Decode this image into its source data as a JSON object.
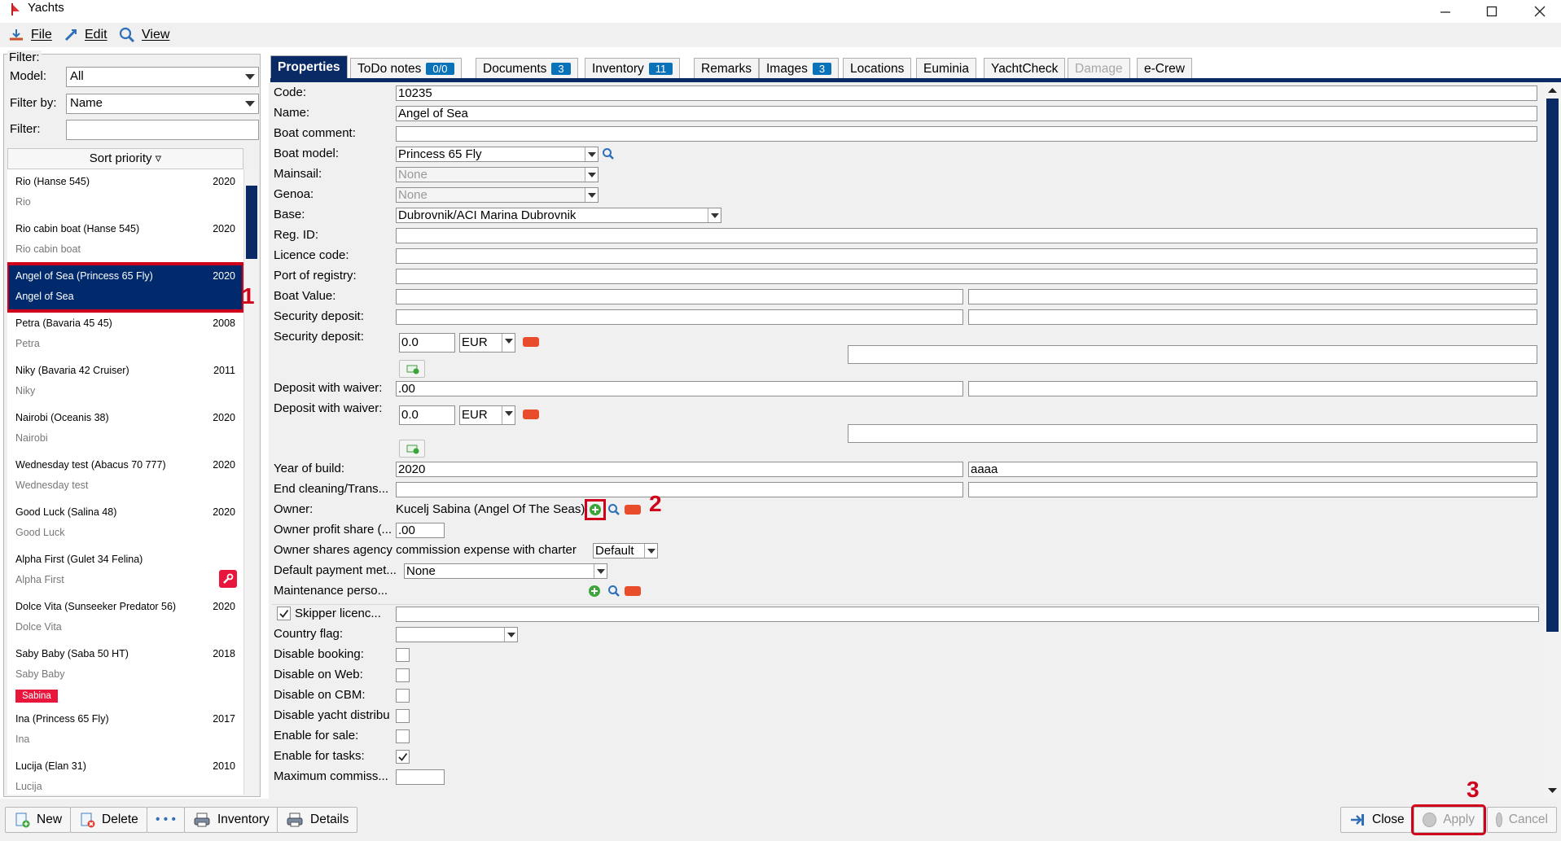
{
  "window": {
    "title": "Yachts",
    "minimize_glyph": "—",
    "maximize_glyph": "☐",
    "close_glyph": "✕"
  },
  "menu": {
    "file": "File",
    "edit": "Edit",
    "view": "View"
  },
  "filter": {
    "heading": "Filter:",
    "model_label": "Model:",
    "model_value": "All",
    "filter_by_label": "Filter by:",
    "filter_by_value": "Name",
    "filter_label": "Filter:",
    "filter_value": ""
  },
  "list": {
    "sort_header": "Sort priority ▿",
    "items": [
      {
        "name": "Rio (Hanse 545)",
        "year": "2020",
        "sub": "Rio"
      },
      {
        "name": "Rio cabin boat (Hanse 545)",
        "year": "2020",
        "sub": "Rio cabin boat"
      },
      {
        "name": "Angel of Sea (Princess 65 Fly)",
        "year": "2020",
        "sub": "Angel of Sea"
      },
      {
        "name": "Petra (Bavaria 45 45)",
        "year": "2008",
        "sub": "Petra"
      },
      {
        "name": "Niky (Bavaria 42 Cruiser)",
        "year": "2011",
        "sub": "Niky"
      },
      {
        "name": "Nairobi (Oceanis 38)",
        "year": "2020",
        "sub": "Nairobi"
      },
      {
        "name": "Wednesday test (Abacus 70 777)",
        "year": "2020",
        "sub": "Wednesday test"
      },
      {
        "name": "Good Luck (Salina 48)",
        "year": "2020",
        "sub": "Good Luck"
      },
      {
        "name": "Alpha First (Gulet 34 Felina)",
        "year": "",
        "sub": "Alpha First"
      },
      {
        "name": "Dolce Vita (Sunseeker Predator 56)",
        "year": "2020",
        "sub": "Dolce Vita"
      },
      {
        "name": "Saby Baby (Saba 50 HT)",
        "year": "2018",
        "sub": "Saby Baby",
        "tag": "Sabina"
      },
      {
        "name": "Ina (Princess 65 Fly)",
        "year": "2017",
        "sub": "Ina"
      },
      {
        "name": "Lucija (Elan 31)",
        "year": "2010",
        "sub": "Lucija"
      }
    ]
  },
  "annotations": {
    "one": "1",
    "two": "2",
    "three": "3"
  },
  "tabs": [
    {
      "label": "Properties",
      "badge": ""
    },
    {
      "label": "ToDo notes",
      "badge": "0/0"
    },
    {
      "label": "Documents",
      "badge": "3"
    },
    {
      "label": "Inventory",
      "badge": "11"
    },
    {
      "label": "Remarks",
      "badge": ""
    },
    {
      "label": "Images",
      "badge": "3"
    },
    {
      "label": "Locations",
      "badge": ""
    },
    {
      "label": "Euminia",
      "badge": ""
    },
    {
      "label": "YachtCheck",
      "badge": ""
    },
    {
      "label": "Damage",
      "badge": ""
    },
    {
      "label": "e-Crew",
      "badge": ""
    }
  ],
  "form": {
    "code_label": "Code:",
    "code_value": "10235",
    "name_label": "Name:",
    "name_value": "Angel of Sea",
    "comment_label": "Boat comment:",
    "comment_value": "",
    "model_label": "Boat model:",
    "model_value": "Princess 65 Fly",
    "mainsail_label": "Mainsail:",
    "mainsail_value": "None",
    "genoa_label": "Genoa:",
    "genoa_value": "None",
    "base_label": "Base:",
    "base_value": "Dubrovnik/ACI Marina Dubrovnik",
    "regid_label": "Reg. ID:",
    "licence_label": "Licence code:",
    "port_label": "Port of registry:",
    "value_label": "Boat Value:",
    "secdep1_label": "Security deposit:",
    "secdep2_label": "Security deposit:",
    "secdep_amount": "0.0",
    "secdep_currency": "EUR",
    "waiver1_label": "Deposit with waiver:",
    "waiver1_value": ".00",
    "waiver2_label": "Deposit with waiver:",
    "waiver_amount": "0.0",
    "waiver_currency": "EUR",
    "year_label": "Year of build:",
    "year_value": "2020",
    "year_value2": "aaaa",
    "endclean_label": "End cleaning/Trans...",
    "owner_label": "Owner:",
    "owner_value": "Kucelj Sabina (Angel Of The Seas)",
    "profit_label": "Owner profit share (...",
    "profit_value": ".00",
    "commission_label": "Owner shares agency commission expense with charter",
    "commission_value": "Default",
    "payment_label": "Default payment met...",
    "payment_value": "None",
    "maint_label": "Maintenance perso...",
    "skipper_label": "Skipper licenc...",
    "flag_label": "Country flag:",
    "disable_booking_label": "Disable booking:",
    "disable_web_label": "Disable on Web:",
    "disable_cbm_label": "Disable on CBM:",
    "disable_distrib_label": "Disable yacht distribu",
    "enable_sale_label": "Enable for sale:",
    "enable_tasks_label": "Enable for tasks:",
    "max_comm_label": "Maximum commiss..."
  },
  "bottom": {
    "new": "New",
    "delete": "Delete",
    "more": "• • •",
    "inventory": "Inventory",
    "details": "Details",
    "close": "Close",
    "apply": "Apply",
    "cancel": "Cancel"
  },
  "colors": {
    "accent": "#0a2a66",
    "badge": "#0a72b8",
    "highlight": "#d0021b",
    "tag": "#e8163c"
  }
}
